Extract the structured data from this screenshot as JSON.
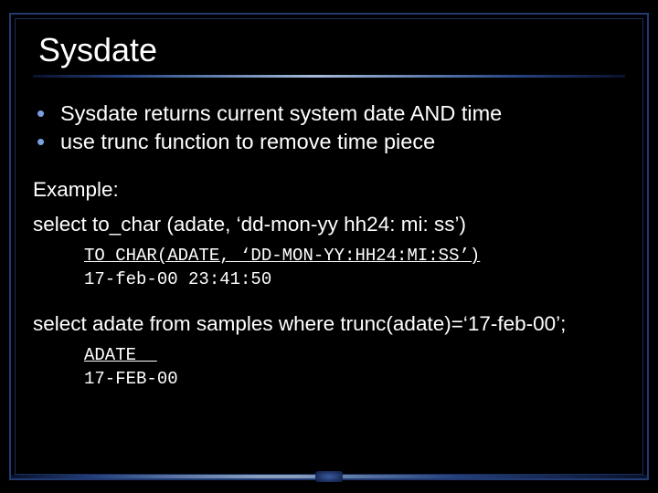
{
  "title": "Sysdate",
  "bullets": [
    "Sysdate returns current system date AND time",
    "use trunc function to remove time piece"
  ],
  "example_label": "Example:",
  "example_sql": "select to_char (adate, ‘dd-mon-yy hh24: mi: ss’)",
  "result1_header": "TO_CHAR(ADATE, ‘DD-MON-YY:HH24:MI:SS’)",
  "result1_value": "17-feb-00 23:41:50",
  "query2": "select adate from samples where trunc(adate)=‘17-feb-00’;",
  "result2_header": "ADATE  ",
  "result2_value": "17-FEB-00"
}
